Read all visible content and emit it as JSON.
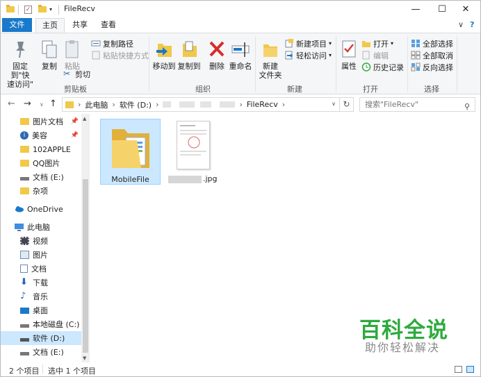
{
  "window": {
    "title": "FileRecv"
  },
  "title_controls": {
    "minimize": "—",
    "maximize": "☐",
    "close": "✕"
  },
  "tabs": {
    "file": "文件",
    "home": "主页",
    "share": "共享",
    "view": "查看"
  },
  "ribbon": {
    "clipboard": {
      "pin_quick_access_line1": "固定到\"快",
      "pin_quick_access_line2": "速访问\"",
      "copy": "复制",
      "paste": "粘贴",
      "copy_path": "复制路径",
      "paste_shortcut": "粘贴快捷方式",
      "cut": "剪切",
      "label": "剪贴板"
    },
    "organize": {
      "move_to": "移动到",
      "copy_to": "复制到",
      "delete": "删除",
      "rename": "重命名",
      "label": "组织"
    },
    "new": {
      "new_folder_line1": "新建",
      "new_folder_line2": "文件夹",
      "new_item": "新建项目",
      "easy_access": "轻松访问",
      "label": "新建"
    },
    "open": {
      "properties": "属性",
      "open": "打开",
      "edit": "编辑",
      "history": "历史记录",
      "label": "打开"
    },
    "select": {
      "select_all": "全部选择",
      "select_none": "全部取消",
      "invert": "反向选择",
      "label": "选择"
    }
  },
  "address": {
    "crumb_root": "此电脑",
    "crumb_drive": "软件 (D:)",
    "crumb_current": "FileRecv",
    "search_placeholder": "搜索\"FileRecv\""
  },
  "nav": {
    "quick": [
      "图片文档",
      "美容",
      "102APPLE",
      "QQ图片",
      "文档 (E:)",
      "杂项"
    ],
    "onedrive": "OneDrive",
    "this_pc": "此电脑",
    "pc_items": [
      "视频",
      "图片",
      "文档",
      "下载",
      "音乐",
      "桌面",
      "本地磁盘 (C:)",
      "软件 (D:)",
      "文档 (E:)"
    ]
  },
  "files": [
    {
      "name": "MobileFile",
      "type": "folder",
      "selected": true
    },
    {
      "name": ".jpg",
      "type": "image",
      "selected": false
    }
  ],
  "status": {
    "count": "2 个项目",
    "selected": "选中 1 个项目"
  },
  "watermark": {
    "brand": "百科全说",
    "slogan": "助你轻松解决"
  },
  "colors": {
    "accent": "#1979ca",
    "selection": "#cce8ff",
    "folder": "#f0c84a",
    "watermark": "#2eaa3e"
  }
}
